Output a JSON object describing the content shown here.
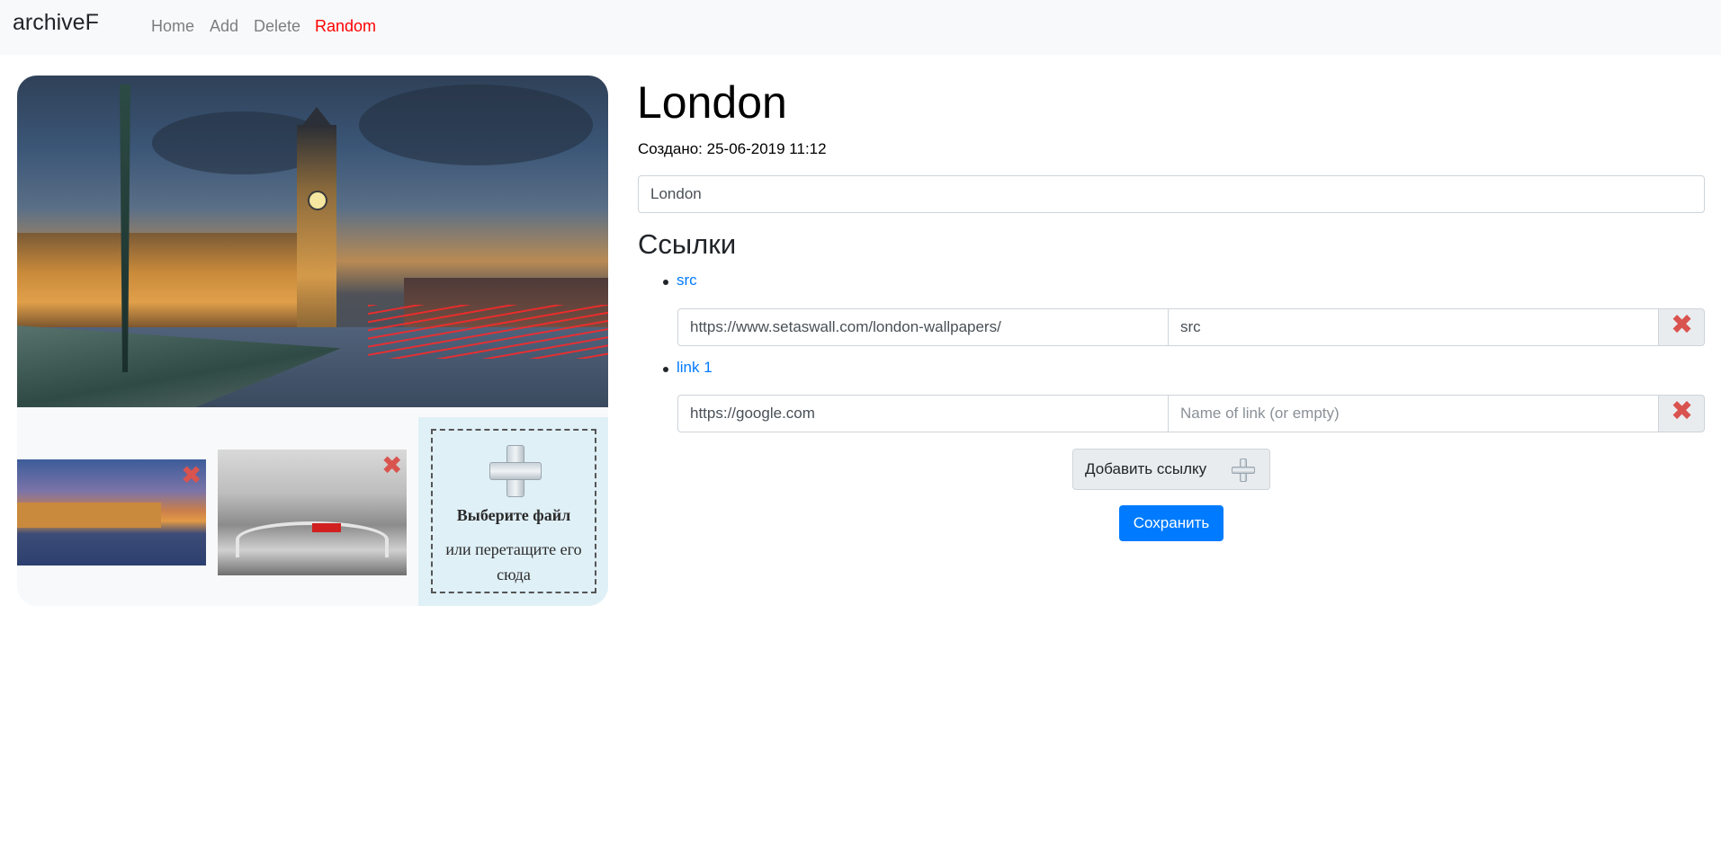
{
  "navbar": {
    "brand": "archiveF",
    "links": [
      {
        "label": "Home",
        "active": false
      },
      {
        "label": "Add",
        "active": false
      },
      {
        "label": "Delete",
        "active": false
      },
      {
        "label": "Random",
        "active": true
      }
    ],
    "active_color": "#ff0000"
  },
  "gallery": {
    "remove_glyph": "✖",
    "dropzone": {
      "title": "Выберите файл",
      "subtitle": "или перетащите его сюда",
      "icon": "plus-icon"
    }
  },
  "record": {
    "title": "London",
    "created": "Создано: 25-06-2019 11:12",
    "name_value": "London"
  },
  "links_section": {
    "heading": "Ссылки",
    "items": [
      {
        "title": "src",
        "url": "https://www.setaswall.com/london-wallpapers/",
        "name": "src",
        "name_placeholder": "Name of link (or empty)"
      },
      {
        "title": "link 1",
        "url": "https://google.com",
        "name": "",
        "name_placeholder": "Name of link (or empty)"
      }
    ],
    "remove_glyph": "✖",
    "add_button": "Добавить ссылку",
    "save_button": "Сохранить"
  },
  "colors": {
    "primary": "#007bff",
    "danger": "#d9534f",
    "navbar_bg": "#f8f9fa",
    "dropzone_bg": "#dff0f7"
  }
}
